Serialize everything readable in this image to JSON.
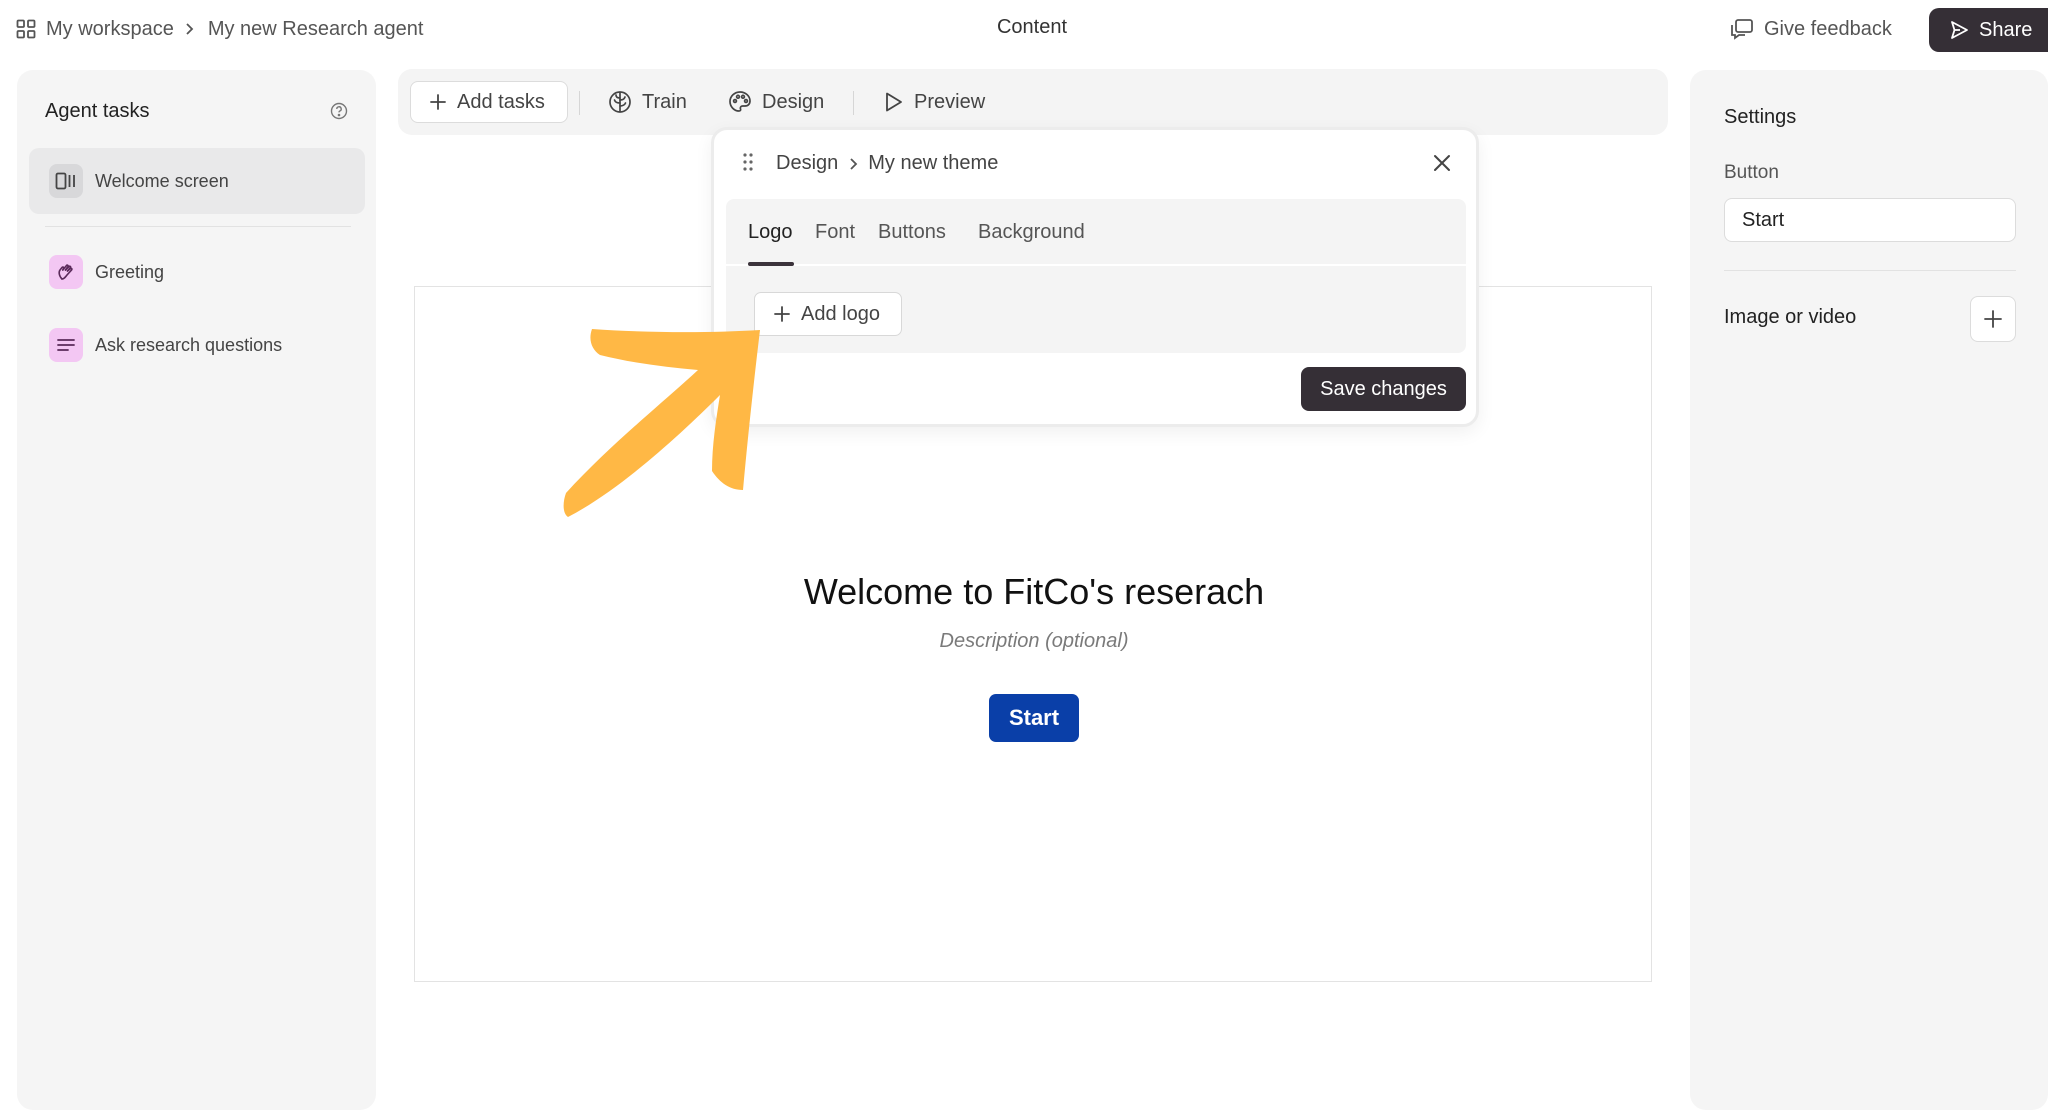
{
  "topbar": {
    "breadcrumb": [
      "My workspace",
      "My new Research agent"
    ],
    "title": "Content",
    "feedback_label": "Give feedback",
    "share_label": "Share"
  },
  "left_panel": {
    "title": "Agent tasks",
    "tasks": [
      {
        "label": "Welcome screen",
        "icon": "welcome-screen-icon",
        "active": true
      },
      {
        "label": "Greeting",
        "icon": "waving-hand-icon",
        "active": false
      },
      {
        "label": "Ask research questions",
        "icon": "text-lines-icon",
        "active": false
      }
    ]
  },
  "toolbar": {
    "add_tasks": "Add tasks",
    "train": "Train",
    "design": "Design",
    "preview": "Preview"
  },
  "popover": {
    "breadcrumb": [
      "Design",
      "My new theme"
    ],
    "tabs": [
      "Logo",
      "Font",
      "Buttons",
      "Background"
    ],
    "active_tab": "Logo",
    "add_logo_label": "Add logo",
    "save_label": "Save changes"
  },
  "canvas": {
    "title": "Welcome to FitCo's reserach",
    "description_placeholder": "Description (optional)",
    "start_label": "Start"
  },
  "right_panel": {
    "title": "Settings",
    "button_label": "Button",
    "button_value": "Start",
    "media_label": "Image or video"
  },
  "colors": {
    "accent_dark": "#352f36",
    "start_button": "#0a3fa8",
    "annotation_arrow": "#ffb845",
    "task_icon_pink": "#f3c7f3"
  }
}
